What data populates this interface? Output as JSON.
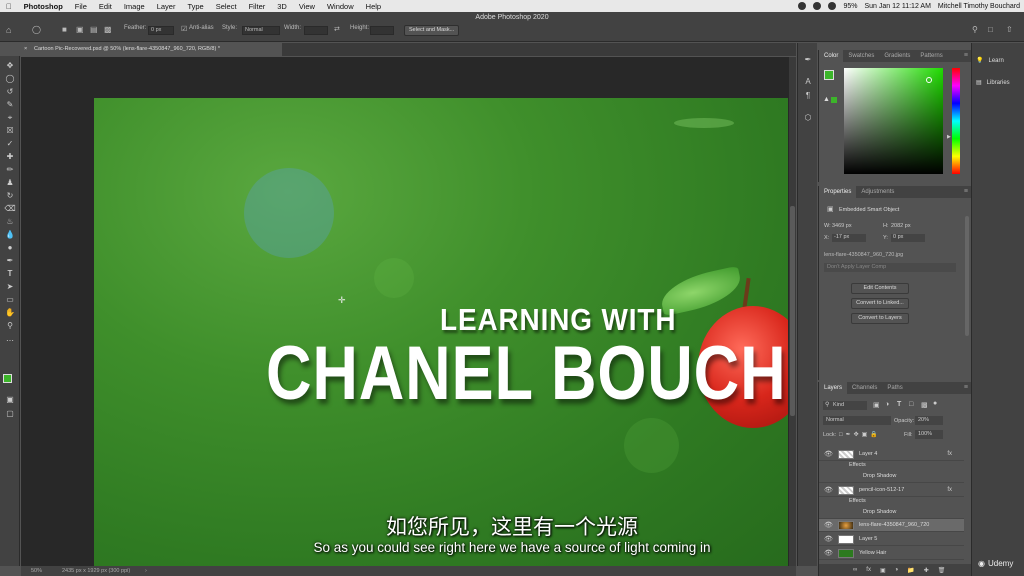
{
  "menubar": {
    "app": "Photoshop",
    "items": [
      "File",
      "Edit",
      "Image",
      "Layer",
      "Type",
      "Select",
      "Filter",
      "3D",
      "View",
      "Window",
      "Help"
    ],
    "battery": "95%",
    "datetime": "Sun Jan 12  11:12 AM",
    "user": "Mitchell Timothy Bouchard"
  },
  "window_title": "Adobe Photoshop 2020",
  "options": {
    "feather_label": "Feather:",
    "feather_value": "0 px",
    "antialias_label": "Anti-alias",
    "style_label": "Style:",
    "style_value": "Normal",
    "width_label": "Width:",
    "height_label": "Height:",
    "select_mask_label": "Select and Mask..."
  },
  "document_tab": "Cartoon Pic-Recovered.psd @ 50% (lens-flare-4350847_960_720, RGB/8) *",
  "canvas": {
    "title_line1": "LEARNING WITH",
    "title_line2": "CHANEL BOUCHAR"
  },
  "statusbar": {
    "zoom": "50%",
    "info": "2435 px x 1929 px (300 ppi)"
  },
  "color_panel": {
    "tabs": [
      "Color",
      "Swatches",
      "Gradients",
      "Patterns"
    ],
    "fg": "#3cb52a",
    "bg": "#cc1111"
  },
  "properties_panel": {
    "tabs": [
      "Properties",
      "Adjustments"
    ],
    "kind": "Embedded Smart Object",
    "w_label": "W:",
    "w_value": "3469 px",
    "h_label": "H:",
    "h_value": "2082 px",
    "x_label": "X:",
    "x_value": "-17 px",
    "y_label": "Y:",
    "y_value": "0 px",
    "filename": "lens-flare-4350847_960_720.jpg",
    "comps": "Don't Apply Layer Comp",
    "btn_edit": "Edit Contents",
    "btn_linked": "Convert to Linked...",
    "btn_layers": "Convert to Layers"
  },
  "layers_panel": {
    "tabs": [
      "Layers",
      "Channels",
      "Paths"
    ],
    "filter": "Kind",
    "blend": "Normal",
    "opacity_label": "Opacity:",
    "opacity": "20%",
    "lock_label": "Lock:",
    "fill_label": "Fill:",
    "fill": "100%",
    "layers": [
      {
        "name": "Layer 4",
        "fx": "fx"
      },
      {
        "name": "Effects",
        "fx": ""
      },
      {
        "name": "Drop Shadow",
        "fx": ""
      },
      {
        "name": "pencil-icon-512-17",
        "fx": "fx"
      },
      {
        "name": "Effects",
        "fx": ""
      },
      {
        "name": "Drop Shadow",
        "fx": ""
      },
      {
        "name": "lens-flare-4350847_960_720",
        "fx": ""
      },
      {
        "name": "Layer 5",
        "fx": ""
      },
      {
        "name": "Yellow Hair",
        "fx": ""
      }
    ]
  },
  "learn_panel": {
    "learn": "Learn",
    "libraries": "Libraries"
  },
  "subtitles": {
    "zh": "如您所见，这里有一个光源",
    "en": "So as you could see right here we have a source of light coming in"
  },
  "watermark": "Udemy"
}
